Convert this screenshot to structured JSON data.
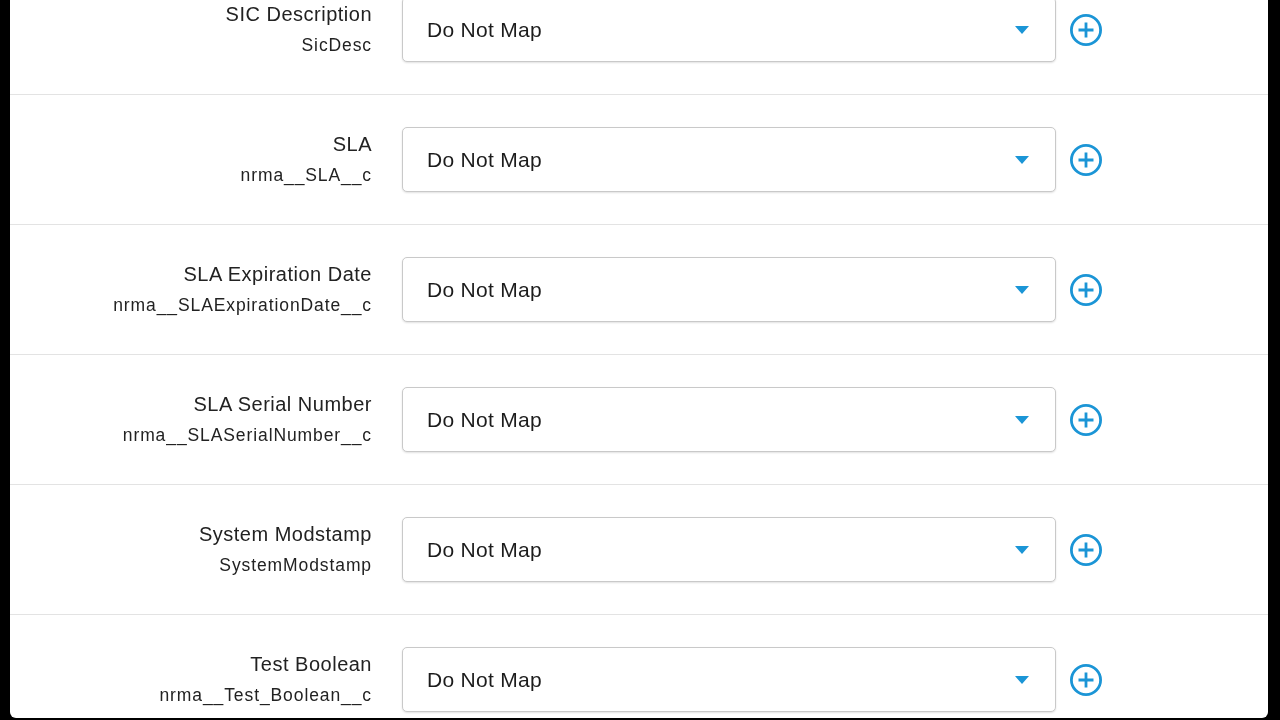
{
  "fields": [
    {
      "label": "SIC Description",
      "api_name": "SicDesc",
      "mapping": "Do Not Map"
    },
    {
      "label": "SLA",
      "api_name": "nrma__SLA__c",
      "mapping": "Do Not Map"
    },
    {
      "label": "SLA Expiration Date",
      "api_name": "nrma__SLAExpirationDate__c",
      "mapping": "Do Not Map"
    },
    {
      "label": "SLA Serial Number",
      "api_name": "nrma__SLASerialNumber__c",
      "mapping": "Do Not Map"
    },
    {
      "label": "System Modstamp",
      "api_name": "SystemModstamp",
      "mapping": "Do Not Map"
    },
    {
      "label": "Test Boolean",
      "api_name": "nrma__Test_Boolean__c",
      "mapping": "Do Not Map"
    }
  ]
}
